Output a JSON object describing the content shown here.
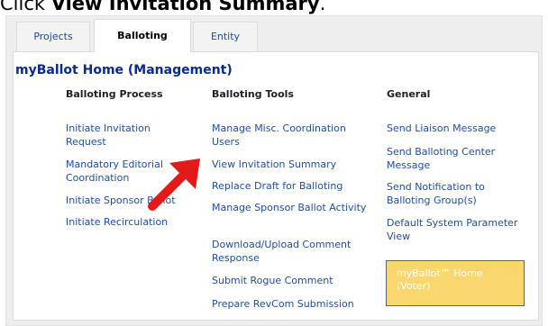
{
  "instruction": {
    "prefix": "Click ",
    "target": "View Invitation Summary",
    "suffix": "."
  },
  "tabs": [
    {
      "label": "Projects",
      "active": false
    },
    {
      "label": "Balloting",
      "active": true
    },
    {
      "label": "Entity",
      "active": false
    }
  ],
  "page_title": "myBallot Home (Management)",
  "columns": [
    {
      "heading": "Balloting Process",
      "links": [
        "Initiate Invitation Request",
        "Mandatory Editorial Coordination",
        "Initiate Sponsor Ballot",
        "Initiate Recirculation"
      ]
    },
    {
      "heading": "Balloting Tools",
      "links": [
        "Manage Misc. Coordination Users",
        "View Invitation Summary",
        "Replace Draft for Balloting",
        "Manage Sponsor Ballot Activity",
        "Download/Upload Comment Response",
        "Submit Rogue Comment",
        "Prepare RevCom Submission"
      ]
    },
    {
      "heading": "General",
      "links": [
        "Send Liaison Message",
        "Send Balloting Center Message",
        "Send Notification to Balloting Group(s)",
        "Default System Parameter View"
      ]
    }
  ],
  "voter_box": {
    "label": "myBallot™ Home (Voter)"
  },
  "colors": {
    "link": "#1f4fa8",
    "title": "#0a2a90",
    "voter_box_bg": "#fad66e",
    "arrow": "#e31a1a"
  },
  "annotation_icon": "red-arrow-icon"
}
